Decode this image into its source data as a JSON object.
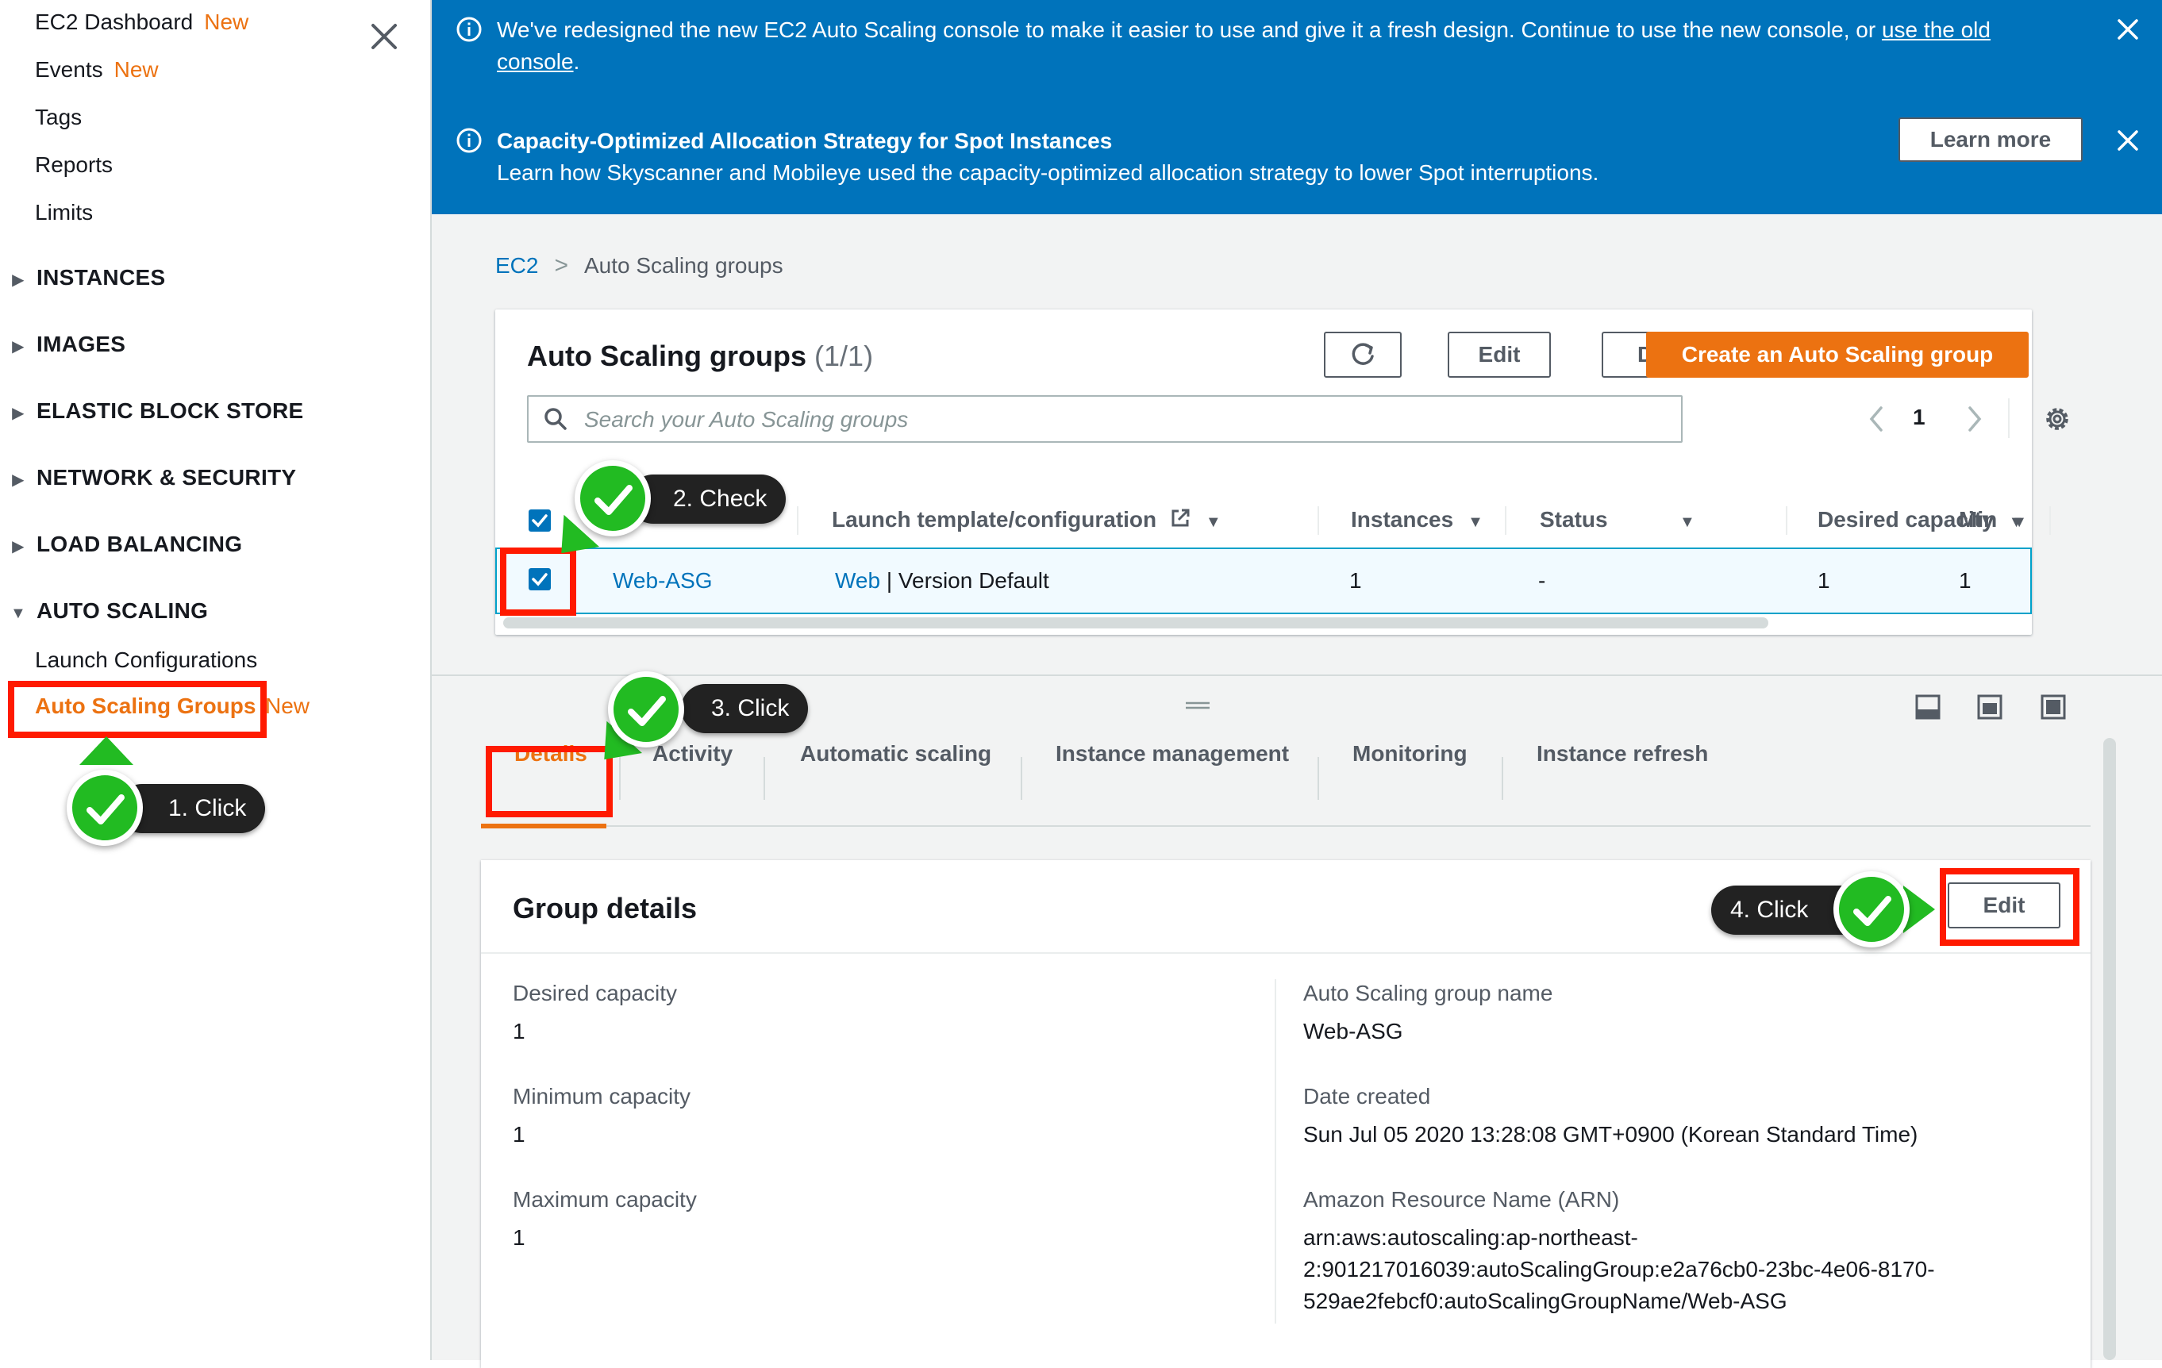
{
  "sidebar": {
    "links": [
      {
        "label": "EC2 Dashboard",
        "badge": "New"
      },
      {
        "label": "Events",
        "badge": "New"
      },
      {
        "label": "Tags",
        "badge": ""
      },
      {
        "label": "Reports",
        "badge": ""
      },
      {
        "label": "Limits",
        "badge": ""
      }
    ],
    "sections": [
      "INSTANCES",
      "IMAGES",
      "ELASTIC BLOCK STORE",
      "NETWORK & SECURITY",
      "LOAD BALANCING",
      "AUTO SCALING"
    ],
    "auto_scaling_items": [
      {
        "label": "Launch Configurations"
      },
      {
        "label": "Auto Scaling Groups",
        "badge": "New"
      }
    ]
  },
  "flash": {
    "message1_text": "We've redesigned the new EC2 Auto Scaling console to make it easier to use and give it a fresh design. Continue to use the new console, or ",
    "message1_link": "use the old console",
    "message1_end": ".",
    "message2_title": "Capacity-Optimized Allocation Strategy for Spot Instances",
    "message2_body": "Learn how Skyscanner and Mobileye used the capacity-optimized allocation strategy to lower Spot interruptions.",
    "learn_more": "Learn more"
  },
  "breadcrumb": {
    "root": "EC2",
    "current": "Auto Scaling groups"
  },
  "asg_table": {
    "title": "Auto Scaling groups",
    "count": "(1/1)",
    "edit": "Edit",
    "delete": "Delete",
    "create": "Create an Auto Scaling group",
    "search_placeholder": "Search your Auto Scaling groups",
    "page": "1",
    "columns": [
      "Launch template/configuration",
      "Instances",
      "Status",
      "Desired capacity",
      "Min"
    ],
    "row": {
      "name": "Web-ASG",
      "template_link": "Web",
      "template_rest": "| Version Default",
      "instances": "1",
      "status": "-",
      "desired": "1",
      "min": "1"
    }
  },
  "details": {
    "tabs": [
      "Details",
      "Activity",
      "Automatic scaling",
      "Instance management",
      "Monitoring",
      "Instance refresh"
    ],
    "card_title": "Group details",
    "edit": "Edit",
    "left": [
      {
        "label": "Desired capacity",
        "value": "1"
      },
      {
        "label": "Minimum capacity",
        "value": "1"
      },
      {
        "label": "Maximum capacity",
        "value": "1"
      }
    ],
    "right": [
      {
        "label": "Auto Scaling group name",
        "value": "Web-ASG"
      },
      {
        "label": "Date created",
        "value": "Sun Jul 05 2020 13:28:08 GMT+0900 (Korean Standard Time)"
      },
      {
        "label": "Amazon Resource Name (ARN)",
        "value_lines": [
          "arn:aws:autoscaling:ap-northeast-",
          "2:901217016039:autoScalingGroup:e2a76cb0-23bc-4e06-8170-",
          "529ae2febcf0:autoScalingGroupName/Web-ASG"
        ]
      }
    ]
  },
  "annotations": {
    "step1": "1. Click",
    "step2": "2. Check",
    "step3": "3. Click",
    "step4": "4. Click"
  },
  "colors": {
    "accent": "#ec7211",
    "link": "#0073bb",
    "flash": "#0073bb",
    "annotation_red": "#ff1a00",
    "annotation_green": "#22bb22"
  }
}
